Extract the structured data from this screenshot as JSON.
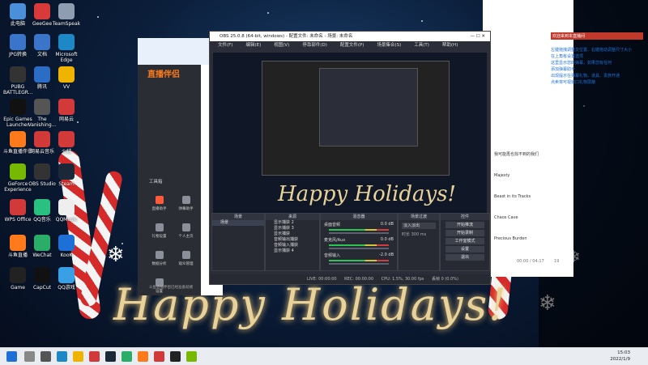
{
  "desktop": {
    "greeting": "Happy Holidays!",
    "icons": [
      {
        "label": "此电脑",
        "color": "#4a90d9"
      },
      {
        "label": "GeeGee",
        "color": "#d83a3a"
      },
      {
        "label": "TeamSpeak",
        "color": "#8f9db0"
      },
      {
        "label": "JPG转换",
        "color": "#3b75c9"
      },
      {
        "label": "文档",
        "color": "#3b75c9"
      },
      {
        "label": "Microsoft Edge",
        "color": "#1e88c7"
      },
      {
        "label": "PUBG BATTLEGR...",
        "color": "#333"
      },
      {
        "label": "腾讯",
        "color": "#2b6cc4"
      },
      {
        "label": "VV",
        "color": "#f0b400"
      },
      {
        "label": "Epic Games Launcher",
        "color": "#111"
      },
      {
        "label": "The Vanishing...",
        "color": "#555"
      },
      {
        "label": "网易云",
        "color": "#d23a3a"
      },
      {
        "label": "斗鱼直播伴侣",
        "color": "#ff7a1a"
      },
      {
        "label": "网易云音乐",
        "color": "#d23a3a"
      },
      {
        "label": "火绒",
        "color": "#d23a3a"
      },
      {
        "label": "GeForce Experience",
        "color": "#76b900"
      },
      {
        "label": "OBS Studio",
        "color": "#333"
      },
      {
        "label": "Steam",
        "color": "#1b2838"
      },
      {
        "label": "WPS Office",
        "color": "#d23a3a"
      },
      {
        "label": "QQ音乐",
        "color": "#29c17f"
      },
      {
        "label": "QQMusic",
        "color": "#eee"
      },
      {
        "label": "斗鱼直播",
        "color": "#ff7a1a"
      },
      {
        "label": "WeChat",
        "color": "#2aae67"
      },
      {
        "label": "KooK",
        "color": "#1e6fd6"
      },
      {
        "label": "Game",
        "color": "#222"
      },
      {
        "label": "CapCut",
        "color": "#111"
      },
      {
        "label": "QQ游戏",
        "color": "#3aa0e6"
      }
    ]
  },
  "left_app": {
    "title": "直播伴侣",
    "section": "工具箱",
    "tools": [
      "直播助手",
      "弹幕助手",
      "礼物设置",
      "个人主页",
      "数据分析",
      "观众管理",
      "设置"
    ],
    "status_text": "斗鱼直播伴侣已经准备就绪"
  },
  "obs": {
    "title": "OBS 25.0.8 (64-bit, windows) - 配置文件: 未命名 - 场景: 未命名",
    "menu": [
      "文件(F)",
      "编辑(E)",
      "视图(V)",
      "停靠部件(D)",
      "配置文件(P)",
      "场景集合(S)",
      "工具(T)",
      "帮助(H)"
    ],
    "docks": {
      "scenes": {
        "title": "场景",
        "items": [
          "场景"
        ]
      },
      "sources": {
        "title": "来源",
        "items": [
          "显示捕获 2",
          "显示捕获 3",
          "显示捕获",
          "音频输出捕获",
          "音频输入捕获",
          "显示捕获 4"
        ]
      },
      "mixer": {
        "title": "混音器",
        "channels": [
          {
            "name": "桌面音频",
            "level": "0.0 dB"
          },
          {
            "name": "麦克风/Aux",
            "level": "0.0 dB"
          },
          {
            "name": "音频输入",
            "level": "-2.0 dB"
          }
        ]
      },
      "transitions": {
        "title": "场景过渡",
        "value": "淡入淡出",
        "duration_label": "时长",
        "duration": "300 ms"
      },
      "controls": {
        "title": "控件",
        "buttons": [
          "开始推流",
          "开始录制",
          "工作室模式",
          "设置",
          "退出"
        ]
      }
    },
    "status": {
      "live": "LIVE: 00:00:00",
      "rec": "REC: 00:00:00",
      "cpu": "CPU: 1.5%, 30.00 fps",
      "dropped": "丢帧 0 (0.0%)"
    }
  },
  "chat_panel": {
    "welcome": "欢迎来到本直播间",
    "lines": [
      "左键拖拽调整文位置、右键拖动调整尺寸大小",
      "在上角有设置选项",
      "这里显示您的弹幕，如果您有任何",
      "添加弹幕助手",
      "出现提示在弹幕礼物、道具、贵族开通",
      "点卖将可视窗口礼物屏蔽"
    ],
    "songs": [
      "我可能再也找不到的我们",
      "Majesty",
      "Beast in its Tracks",
      "Chaos Cave",
      "Precious Burden"
    ],
    "footer_time": "00:00 / 04:17",
    "footer_count": "19"
  },
  "clock": {
    "time": "15:03",
    "date": "2022/1/9"
  }
}
